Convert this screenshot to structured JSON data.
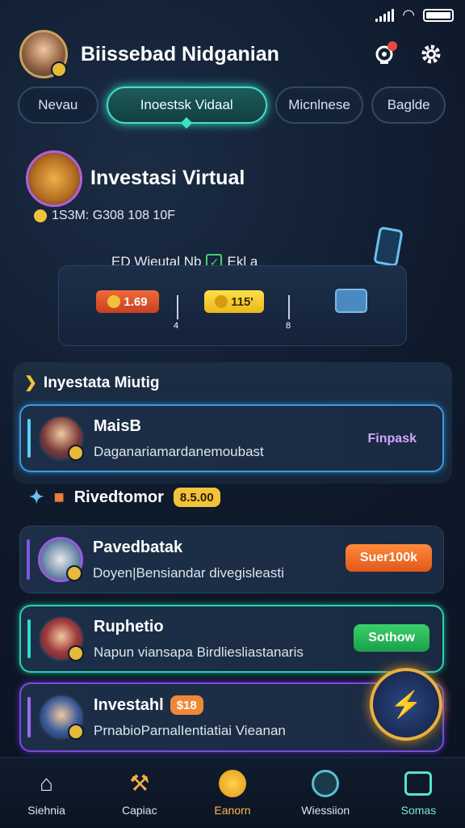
{
  "header": {
    "user_name": "Biissebad Nidganian",
    "notification_icon": "notification-icon",
    "settings_icon": "gear-icon"
  },
  "tabs": [
    {
      "label": "Nevau",
      "active": false
    },
    {
      "label": "Inoestsk Vidaal",
      "active": true
    },
    {
      "label": "Micnlnese",
      "active": false
    },
    {
      "label": "Baglde",
      "active": false
    }
  ],
  "hero": {
    "title": "Investasi Virtual",
    "subtitle": "1S3M: G308 108 10F",
    "middle_text": "ED Wieutal  Nb",
    "middle_text_2": "Ekl a",
    "pill_orange": "1.69",
    "pill_yellow": "115'",
    "tick1": "4",
    "tick2": "8"
  },
  "section1": {
    "title": "Inyestata Miutig",
    "card": {
      "title": "MaisB",
      "subtitle": "Daganariamardanemoubast",
      "button": "Finpask"
    }
  },
  "row2": {
    "title": "Rivedtomor",
    "tag": "8.5.00"
  },
  "cards": [
    {
      "title": "Pavedbatak",
      "subtitle": "Doyen|Bensiandar divegisleasti",
      "button": "Suer100k"
    },
    {
      "title": "Ruphetio",
      "subtitle": "Napun viansapa Birdliesliastanaris",
      "button": "Sothow"
    },
    {
      "title": "Investahl",
      "tag": "$18",
      "subtitle": "PrnabioParnalIentiatiai Vieanan"
    }
  ],
  "fab_icon": "lightning-icon",
  "nav": [
    {
      "label": "Siehnia",
      "icon": "home-icon"
    },
    {
      "label": "Capiac",
      "icon": "tools-icon"
    },
    {
      "label": "Eanorn",
      "icon": "coin-icon"
    },
    {
      "label": "Wiessiion",
      "icon": "profile-icon"
    },
    {
      "label": "Somas",
      "icon": "grid-icon"
    }
  ]
}
